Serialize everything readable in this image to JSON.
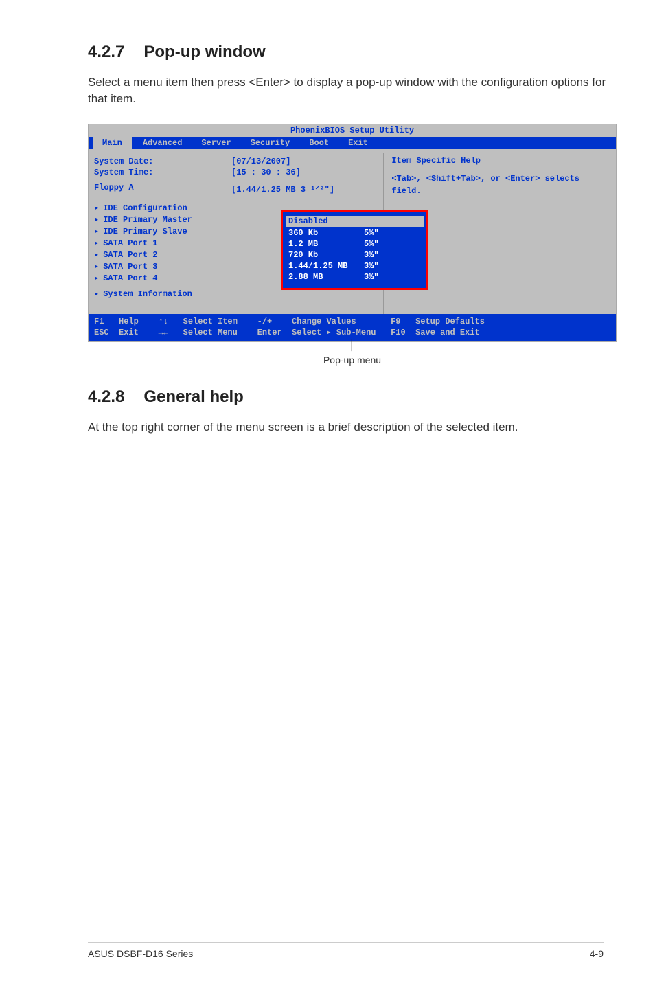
{
  "section_popup": {
    "number": "4.2.7",
    "title": "Pop-up window",
    "paragraph": "Select a menu item then press <Enter> to display a pop-up window with the configuration options for that item."
  },
  "section_help": {
    "number": "4.2.8",
    "title": "General help",
    "paragraph": "At the top right corner of the menu screen is a brief description of the selected item."
  },
  "bios": {
    "title": "PhoenixBIOS Setup Utility",
    "tabs": [
      "Main",
      "Advanced",
      "Server",
      "Security",
      "Boot",
      "Exit"
    ],
    "active_tab": 0,
    "left_rows": [
      {
        "label": "System Date:",
        "val": "[07/13/2007]"
      },
      {
        "label": "System Time:",
        "val": "[15 : 30 : 36]"
      },
      {
        "label": "Floppy A",
        "val": "[1.44/1.25 MB  3 ¹⸍²ʺ]"
      }
    ],
    "menu_items": [
      "IDE Configuration",
      "IDE Primary Master",
      "IDE Primary Slave",
      "SATA Port 1",
      "SATA Port 2",
      "SATA Port 3",
      "SATA Port 4",
      "System Information"
    ],
    "help_title": "Item Specific Help",
    "help_text": "<Tab>, <Shift+Tab>, or <Enter> selects field.",
    "popup_selected": "Disabled",
    "popup_options": [
      {
        "l": "360 Kb",
        "r": "5¼ʺ"
      },
      {
        "l": "1.2 MB",
        "r": "5¼ʺ"
      },
      {
        "l": "720 Kb",
        "r": "3½ʺ"
      },
      {
        "l": "1.44/1.25 MB",
        "r": "3½ʺ"
      },
      {
        "l": "2.88 MB",
        "r": "3½ʺ"
      }
    ],
    "footer_line1": "F1   Help    ↑↓   Select Item    -/+    Change Values       F9   Setup Defaults",
    "footer_line2": "ESC  Exit    →←   Select Menu    Enter  Select ▸ Sub-Menu   F10  Save and Exit"
  },
  "popup_caption": "Pop-up menu",
  "footer": {
    "left": "ASUS DSBF-D16 Series",
    "right": "4-9"
  }
}
